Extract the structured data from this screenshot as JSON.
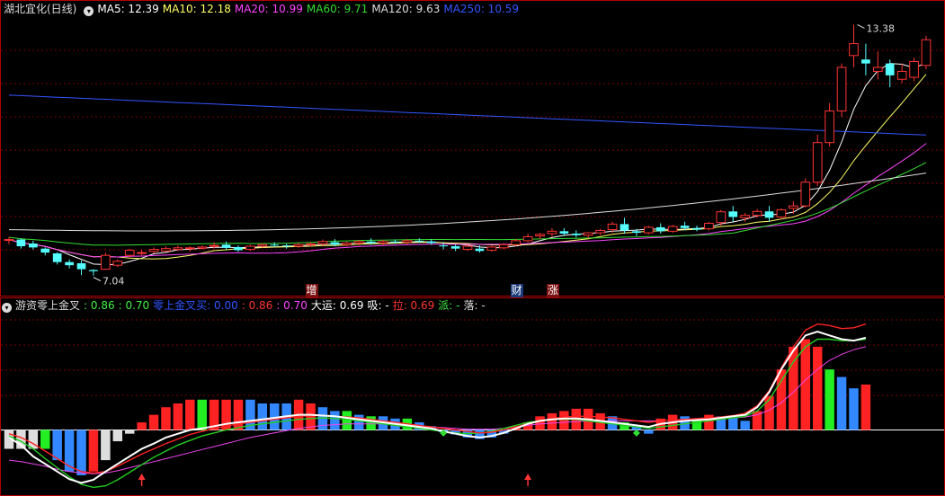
{
  "header": {
    "stock": "湖北宜化(日线)",
    "ma_labels": [
      {
        "text": "MA5: 12.39",
        "color": "#ffffff"
      },
      {
        "text": "MA10: 12.18",
        "color": "#ffff66"
      },
      {
        "text": "MA20: 10.99",
        "color": "#ff44ff"
      },
      {
        "text": "MA60: 9.71",
        "color": "#33dd33"
      },
      {
        "text": "MA120: 9.63",
        "color": "#dddddd"
      },
      {
        "text": "MA250: 10.59",
        "color": "#3355ff"
      }
    ]
  },
  "indicator_header": {
    "name": "游资零上金叉",
    "values": [
      {
        "text": ": 0.86",
        "color": "#44ee44"
      },
      {
        "text": ": 0.70",
        "color": "#44ee44"
      },
      {
        "text": "零上金叉买: 0.00",
        "color": "#3355ff"
      },
      {
        "text": ": 0.86",
        "color": "#ff3333"
      },
      {
        "text": ": 0.70",
        "color": "#ff44ff"
      },
      {
        "text": "大运: 0.69",
        "color": "#ffffff"
      },
      {
        "text": "吸: -",
        "color": "#ffffff"
      },
      {
        "text": "拉: 0.69",
        "color": "#ff3333"
      },
      {
        "text": "派: -",
        "color": "#44ee44"
      },
      {
        "text": "落: -",
        "color": "#dddddd"
      }
    ]
  },
  "badges": [
    {
      "text": "增",
      "color": "#ffffff",
      "bg": "#7a1010",
      "bar": 25
    },
    {
      "text": "财",
      "color": "#ffffff",
      "bg": "#1a3a7a",
      "bar": 42
    },
    {
      "text": "涨",
      "color": "#ffffff",
      "bg": "#7a1010",
      "bar": 45
    }
  ],
  "colors": {
    "up": "#ff3333",
    "down": "#55ffff",
    "grid": "#7a0000"
  },
  "chart_data": {
    "type": "candlestick",
    "high_label": "13.38",
    "low_label": "7.04",
    "candles": [
      [
        7.93,
        8.02,
        7.83,
        7.95
      ],
      [
        7.95,
        7.98,
        7.72,
        7.78
      ],
      [
        7.85,
        7.92,
        7.7,
        7.75
      ],
      [
        7.72,
        7.75,
        7.55,
        7.62
      ],
      [
        7.6,
        7.63,
        7.32,
        7.38
      ],
      [
        7.38,
        7.45,
        7.22,
        7.3
      ],
      [
        7.35,
        7.42,
        7.05,
        7.2
      ],
      [
        7.18,
        7.2,
        7.04,
        7.15
      ],
      [
        7.2,
        7.62,
        7.18,
        7.55
      ],
      [
        7.3,
        7.45,
        7.25,
        7.4
      ],
      [
        7.55,
        7.72,
        7.5,
        7.68
      ],
      [
        7.6,
        7.7,
        7.55,
        7.62
      ],
      [
        7.65,
        7.75,
        7.6,
        7.7
      ],
      [
        7.66,
        7.78,
        7.64,
        7.72
      ],
      [
        7.7,
        7.8,
        7.66,
        7.74
      ],
      [
        7.72,
        7.78,
        7.65,
        7.74
      ],
      [
        7.73,
        7.8,
        7.7,
        7.76
      ],
      [
        7.78,
        7.88,
        7.72,
        7.8
      ],
      [
        7.82,
        7.9,
        7.7,
        7.74
      ],
      [
        7.76,
        7.8,
        7.64,
        7.68
      ],
      [
        7.7,
        7.82,
        7.66,
        7.78
      ],
      [
        7.78,
        7.86,
        7.74,
        7.82
      ],
      [
        7.82,
        7.88,
        7.76,
        7.8
      ],
      [
        7.8,
        7.84,
        7.72,
        7.78
      ],
      [
        7.78,
        7.86,
        7.74,
        7.82
      ],
      [
        7.82,
        7.88,
        7.77,
        7.84
      ],
      [
        7.84,
        7.95,
        7.8,
        7.9
      ],
      [
        7.88,
        7.96,
        7.78,
        7.82
      ],
      [
        7.82,
        7.9,
        7.78,
        7.86
      ],
      [
        7.86,
        7.94,
        7.8,
        7.9
      ],
      [
        7.9,
        7.98,
        7.82,
        7.86
      ],
      [
        7.86,
        7.94,
        7.8,
        7.9
      ],
      [
        7.9,
        7.95,
        7.84,
        7.88
      ],
      [
        7.88,
        7.96,
        7.82,
        7.92
      ],
      [
        7.92,
        7.98,
        7.86,
        7.9
      ],
      [
        7.9,
        7.96,
        7.82,
        7.86
      ],
      [
        7.8,
        7.88,
        7.7,
        7.78
      ],
      [
        7.78,
        7.82,
        7.66,
        7.72
      ],
      [
        7.7,
        7.82,
        7.66,
        7.78
      ],
      [
        7.72,
        7.8,
        7.62,
        7.66
      ],
      [
        7.68,
        7.8,
        7.64,
        7.76
      ],
      [
        7.74,
        7.86,
        7.7,
        7.82
      ],
      [
        7.82,
        7.96,
        7.78,
        7.92
      ],
      [
        7.92,
        8.1,
        7.88,
        8.02
      ],
      [
        8.04,
        8.12,
        7.96,
        8.08
      ],
      [
        8.1,
        8.24,
        8.02,
        8.16
      ],
      [
        8.16,
        8.24,
        8.04,
        8.1
      ],
      [
        8.1,
        8.18,
        8.0,
        8.06
      ],
      [
        8.06,
        8.14,
        7.98,
        8.12
      ],
      [
        8.12,
        8.22,
        8.06,
        8.18
      ],
      [
        8.2,
        8.4,
        8.12,
        8.34
      ],
      [
        8.34,
        8.5,
        8.1,
        8.18
      ],
      [
        8.16,
        8.22,
        8.04,
        8.12
      ],
      [
        8.12,
        8.3,
        8.08,
        8.26
      ],
      [
        8.26,
        8.36,
        8.1,
        8.16
      ],
      [
        8.16,
        8.32,
        8.12,
        8.28
      ],
      [
        8.3,
        8.4,
        8.18,
        8.24
      ],
      [
        8.24,
        8.3,
        8.16,
        8.2
      ],
      [
        8.22,
        8.4,
        8.18,
        8.36
      ],
      [
        8.38,
        8.7,
        8.3,
        8.65
      ],
      [
        8.66,
        8.8,
        8.4,
        8.52
      ],
      [
        8.5,
        8.62,
        8.4,
        8.56
      ],
      [
        8.56,
        8.72,
        8.5,
        8.66
      ],
      [
        8.66,
        8.8,
        8.4,
        8.5
      ],
      [
        8.52,
        8.74,
        8.46,
        8.7
      ],
      [
        8.74,
        8.92,
        8.6,
        8.8
      ],
      [
        8.8,
        9.5,
        8.76,
        9.4
      ],
      [
        9.4,
        10.6,
        9.3,
        10.4
      ],
      [
        10.4,
        11.4,
        10.3,
        11.2
      ],
      [
        11.2,
        12.4,
        11.05,
        12.3
      ],
      [
        12.6,
        13.38,
        12.3,
        12.9
      ],
      [
        12.5,
        12.9,
        12.1,
        12.4
      ],
      [
        12.2,
        12.7,
        12.0,
        12.3
      ],
      [
        12.4,
        12.5,
        11.8,
        12.1
      ],
      [
        12.0,
        12.4,
        11.9,
        12.2
      ],
      [
        12.05,
        12.55,
        11.95,
        12.45
      ],
      [
        12.35,
        13.1,
        12.25,
        13.0
      ]
    ],
    "ma": [
      {
        "name": "MA5",
        "color": "#ffffff"
      },
      {
        "name": "MA10",
        "color": "#ffff66"
      },
      {
        "name": "MA20",
        "color": "#ff44ff"
      },
      {
        "name": "MA60",
        "color": "#33dd33"
      },
      {
        "name": "MA120",
        "color": "#dddddd",
        "start": 8.2,
        "end": 9.63
      },
      {
        "name": "MA250",
        "color": "#3355ff",
        "start": 11.6,
        "end": 10.59
      }
    ],
    "indicator": {
      "bars": [
        [
          -0.25,
          "w"
        ],
        [
          -0.25,
          "w"
        ],
        [
          -0.25,
          "w"
        ],
        [
          -0.25,
          "g"
        ],
        [
          -0.4,
          "b"
        ],
        [
          -0.55,
          "b"
        ],
        [
          -0.6,
          "b"
        ],
        [
          -0.55,
          "r"
        ],
        [
          -0.4,
          "w"
        ],
        [
          -0.15,
          "w"
        ],
        [
          -0.05,
          "w"
        ],
        [
          0.1,
          "r"
        ],
        [
          0.2,
          "r"
        ],
        [
          0.3,
          "r"
        ],
        [
          0.35,
          "r"
        ],
        [
          0.4,
          "r"
        ],
        [
          0.4,
          "g"
        ],
        [
          0.4,
          "r"
        ],
        [
          0.4,
          "r"
        ],
        [
          0.4,
          "r"
        ],
        [
          0.4,
          "b"
        ],
        [
          0.35,
          "b"
        ],
        [
          0.35,
          "b"
        ],
        [
          0.35,
          "b"
        ],
        [
          0.4,
          "r"
        ],
        [
          0.35,
          "r"
        ],
        [
          0.3,
          "b"
        ],
        [
          0.25,
          "b"
        ],
        [
          0.25,
          "g"
        ],
        [
          0.2,
          "b"
        ],
        [
          0.18,
          "g"
        ],
        [
          0.18,
          "b"
        ],
        [
          0.15,
          "b"
        ],
        [
          0.15,
          "g"
        ],
        [
          0.1,
          "b"
        ],
        [
          0.05,
          "b"
        ],
        [
          -0.03,
          "b"
        ],
        [
          -0.06,
          "b"
        ],
        [
          -0.1,
          "b"
        ],
        [
          -0.12,
          "b"
        ],
        [
          -0.1,
          "b"
        ],
        [
          -0.05,
          "b"
        ],
        [
          0.05,
          "r"
        ],
        [
          0.1,
          "r"
        ],
        [
          0.18,
          "r"
        ],
        [
          0.22,
          "r"
        ],
        [
          0.25,
          "r"
        ],
        [
          0.28,
          "r"
        ],
        [
          0.28,
          "r"
        ],
        [
          0.22,
          "r"
        ],
        [
          0.18,
          "b"
        ],
        [
          0.1,
          "g"
        ],
        [
          0.05,
          "b"
        ],
        [
          -0.05,
          "b"
        ],
        [
          0.15,
          "r"
        ],
        [
          0.2,
          "r"
        ],
        [
          0.18,
          "b"
        ],
        [
          0.15,
          "g"
        ],
        [
          0.2,
          "r"
        ],
        [
          0.18,
          "b"
        ],
        [
          0.16,
          "b"
        ],
        [
          0.12,
          "b"
        ],
        [
          0.25,
          "r"
        ],
        [
          0.45,
          "r"
        ],
        [
          0.8,
          "r"
        ],
        [
          1.1,
          "r"
        ],
        [
          1.2,
          "r"
        ],
        [
          1.1,
          "r"
        ],
        [
          0.8,
          "g"
        ],
        [
          0.7,
          "b"
        ],
        [
          0.55,
          "b"
        ],
        [
          0.6,
          "r"
        ]
      ],
      "line_white": [
        -0.1,
        -0.2,
        -0.35,
        -0.45,
        -0.55,
        -0.65,
        -0.7,
        -0.66,
        -0.55,
        -0.45,
        -0.35,
        -0.25,
        -0.18,
        -0.1,
        -0.05,
        0.0,
        0.02,
        0.05,
        0.08,
        0.1,
        0.12,
        0.14,
        0.16,
        0.18,
        0.2,
        0.2,
        0.19,
        0.18,
        0.16,
        0.14,
        0.12,
        0.1,
        0.08,
        0.06,
        0.04,
        0.02,
        -0.02,
        -0.05,
        -0.08,
        -0.1,
        -0.08,
        -0.04,
        0.02,
        0.08,
        0.12,
        0.14,
        0.15,
        0.15,
        0.14,
        0.12,
        0.1,
        0.08,
        0.06,
        0.04,
        0.08,
        0.1,
        0.12,
        0.13,
        0.14,
        0.16,
        0.18,
        0.2,
        0.3,
        0.5,
        0.8,
        1.05,
        1.25,
        1.3,
        1.25,
        1.2,
        1.18,
        1.22
      ],
      "line_red": [
        -0.05,
        -0.1,
        -0.18,
        -0.28,
        -0.38,
        -0.48,
        -0.55,
        -0.57,
        -0.55,
        -0.48,
        -0.4,
        -0.32,
        -0.25,
        -0.18,
        -0.12,
        -0.06,
        -0.02,
        0.02,
        0.05,
        0.08,
        0.1,
        0.12,
        0.14,
        0.16,
        0.18,
        0.19,
        0.19,
        0.18,
        0.17,
        0.16,
        0.14,
        0.12,
        0.1,
        0.08,
        0.06,
        0.04,
        0.02,
        0.0,
        -0.02,
        -0.04,
        -0.03,
        0.0,
        0.04,
        0.08,
        0.12,
        0.15,
        0.17,
        0.18,
        0.18,
        0.17,
        0.16,
        0.14,
        0.12,
        0.1,
        0.12,
        0.13,
        0.14,
        0.15,
        0.16,
        0.17,
        0.19,
        0.22,
        0.32,
        0.52,
        0.82,
        1.1,
        1.32,
        1.4,
        1.38,
        1.34,
        1.35,
        1.4
      ],
      "line_green": [
        -0.08,
        -0.15,
        -0.25,
        -0.38,
        -0.5,
        -0.62,
        -0.72,
        -0.76,
        -0.74,
        -0.66,
        -0.56,
        -0.46,
        -0.36,
        -0.28,
        -0.2,
        -0.14,
        -0.08,
        -0.04,
        0.0,
        0.03,
        0.06,
        0.08,
        0.1,
        0.12,
        0.14,
        0.15,
        0.16,
        0.15,
        0.14,
        0.12,
        0.1,
        0.08,
        0.06,
        0.04,
        0.02,
        0.0,
        -0.02,
        -0.04,
        -0.05,
        -0.04,
        -0.02,
        0.02,
        0.06,
        0.1,
        0.12,
        0.14,
        0.14,
        0.14,
        0.12,
        0.1,
        0.08,
        0.06,
        0.04,
        0.02,
        0.04,
        0.06,
        0.08,
        0.1,
        0.12,
        0.14,
        0.16,
        0.18,
        0.25,
        0.4,
        0.65,
        0.9,
        1.1,
        1.2,
        1.2,
        1.18,
        1.18,
        1.2
      ],
      "line_magenta": [
        -0.4,
        -0.42,
        -0.45,
        -0.48,
        -0.52,
        -0.55,
        -0.57,
        -0.58,
        -0.57,
        -0.54,
        -0.5,
        -0.46,
        -0.42,
        -0.38,
        -0.34,
        -0.3,
        -0.26,
        -0.22,
        -0.18,
        -0.14,
        -0.1,
        -0.07,
        -0.04,
        -0.01,
        0.02,
        0.04,
        0.06,
        0.07,
        0.08,
        0.08,
        0.08,
        0.08,
        0.07,
        0.06,
        0.05,
        0.04,
        0.03,
        0.02,
        0.01,
        0.01,
        0.01,
        0.02,
        0.04,
        0.06,
        0.08,
        0.09,
        0.1,
        0.11,
        0.12,
        0.12,
        0.12,
        0.12,
        0.12,
        0.12,
        0.12,
        0.13,
        0.13,
        0.14,
        0.14,
        0.15,
        0.16,
        0.17,
        0.2,
        0.26,
        0.36,
        0.5,
        0.66,
        0.8,
        0.92,
        1.0,
        1.06,
        1.1
      ],
      "markers": [
        {
          "type": "arrow-up",
          "bar": 11,
          "color": "#ff3333"
        },
        {
          "type": "arrow-up",
          "bar": 43,
          "color": "#ff3333"
        },
        {
          "type": "diamond",
          "bar": 36,
          "color": "#33dd33"
        },
        {
          "type": "diamond",
          "bar": 52,
          "color": "#33dd33"
        }
      ]
    }
  }
}
